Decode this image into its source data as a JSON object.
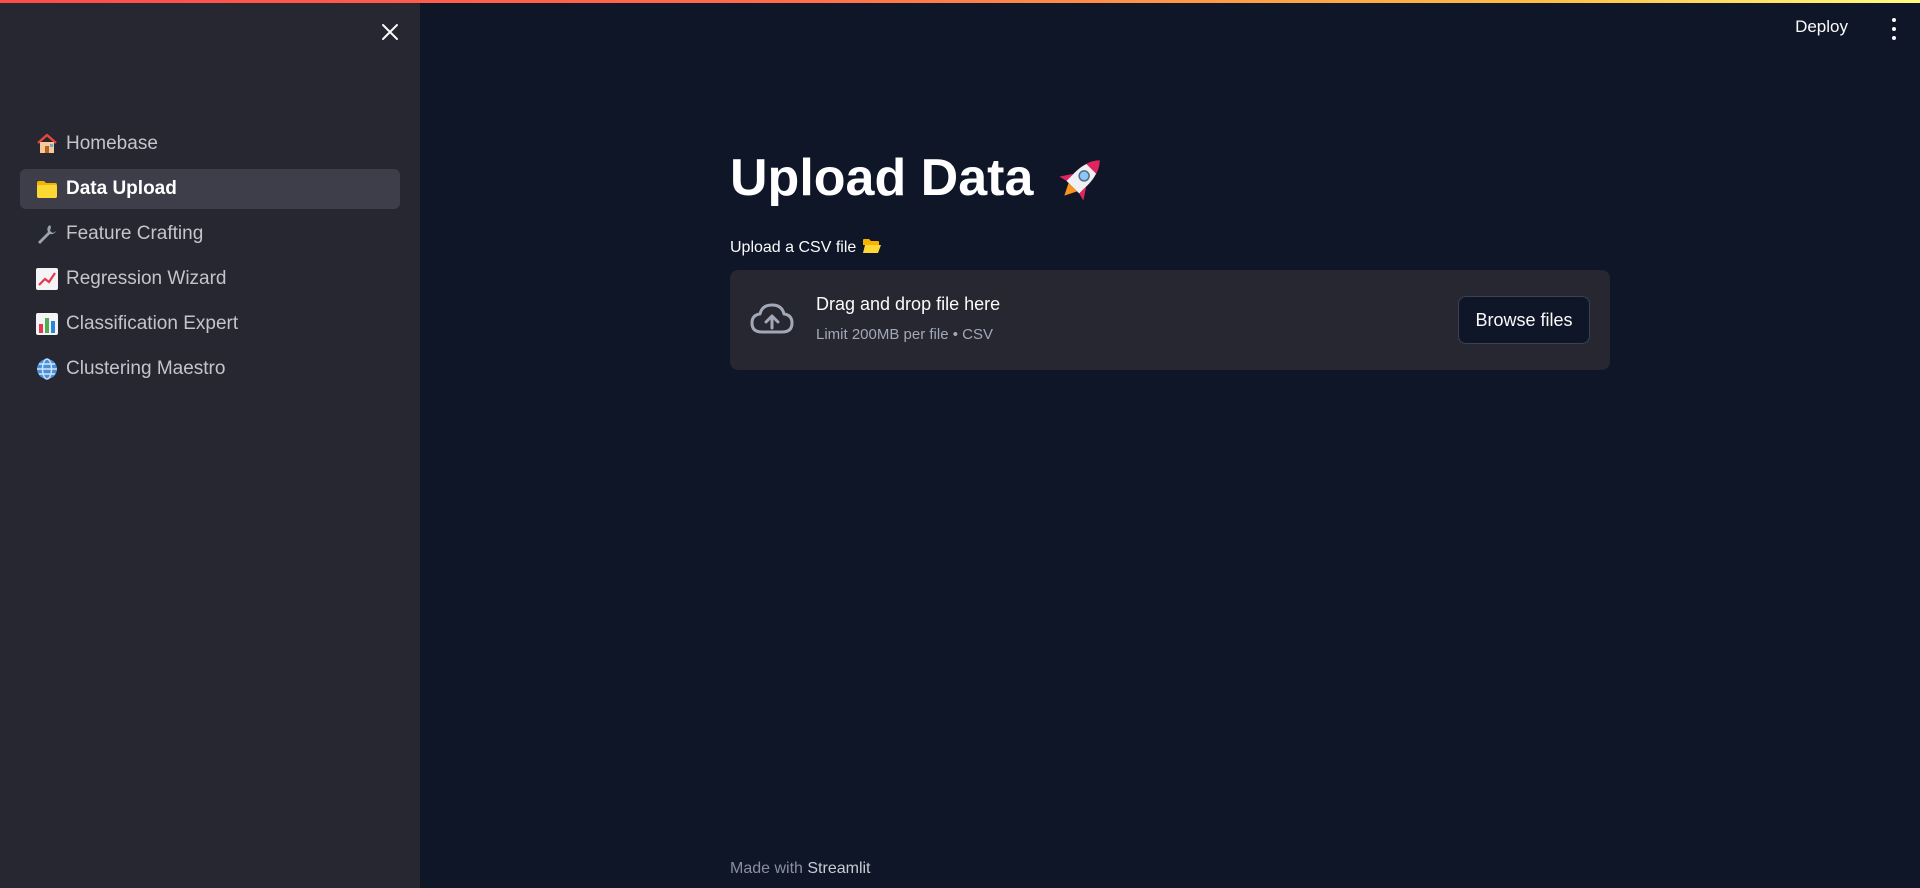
{
  "sidebar": {
    "items": [
      {
        "label": "Homebase",
        "icon": "house-icon",
        "active": false
      },
      {
        "label": "Data Upload",
        "icon": "folder-icon",
        "active": true
      },
      {
        "label": "Feature Crafting",
        "icon": "wrench-icon",
        "active": false
      },
      {
        "label": "Regression Wizard",
        "icon": "line-chart-icon",
        "active": false
      },
      {
        "label": "Classification Expert",
        "icon": "bar-chart-icon",
        "active": false
      },
      {
        "label": "Clustering Maestro",
        "icon": "globe-icon",
        "active": false
      }
    ]
  },
  "header": {
    "deploy_label": "Deploy"
  },
  "main": {
    "title": "Upload Data",
    "title_icon": "rocket-icon",
    "uploader": {
      "label": "Upload a CSV file",
      "label_icon": "open-folder-icon",
      "drop_text": "Drag and drop file here",
      "limit_text": "Limit 200MB per file • CSV",
      "browse_label": "Browse files"
    }
  },
  "footer": {
    "prefix": "Made with",
    "brand": "Streamlit"
  },
  "colors": {
    "main_bg": "#0e1628",
    "sidebar_bg": "#262730",
    "active_item_bg": "#3d3e4a",
    "accent_stripe_start": "#ff4b4b",
    "accent_stripe_end": "#fffd80"
  }
}
